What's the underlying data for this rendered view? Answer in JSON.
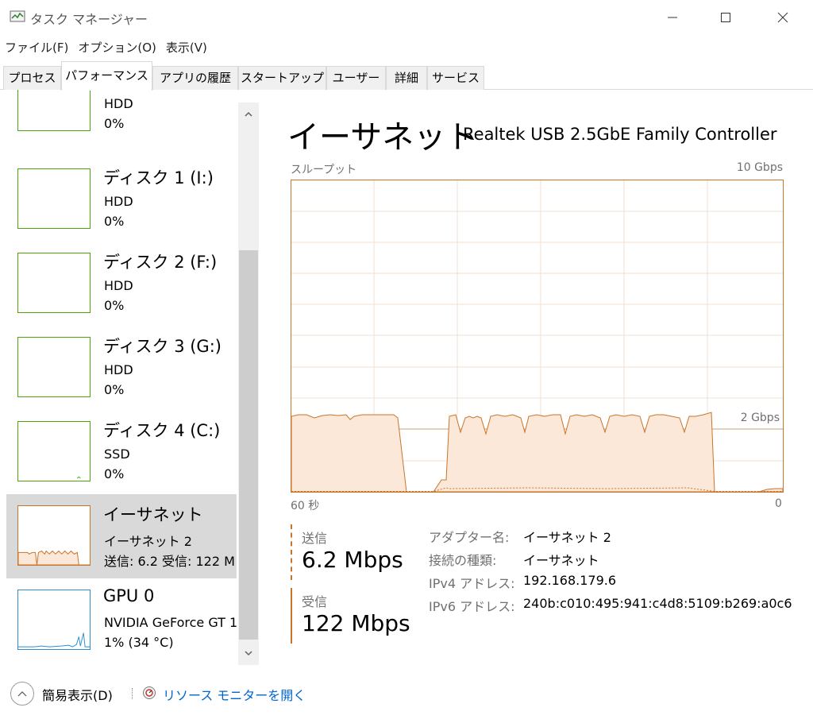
{
  "window": {
    "title": "タスク マネージャー",
    "icon": "task-manager-icon"
  },
  "menu": [
    "ファイル(F)",
    "オプション(O)",
    "表示(V)"
  ],
  "tabs": [
    {
      "label": "プロセス",
      "active": false
    },
    {
      "label": "パフォーマンス",
      "active": true
    },
    {
      "label": "アプリの履歴",
      "active": false
    },
    {
      "label": "スタートアップ",
      "active": false
    },
    {
      "label": "ユーザー",
      "active": false
    },
    {
      "label": "詳細",
      "active": false
    },
    {
      "label": "サービス",
      "active": false
    }
  ],
  "sidebar": {
    "items": [
      {
        "name": "",
        "sub": "HDD",
        "value": "0%"
      },
      {
        "name": "ディスク 1 (I:)",
        "sub": "HDD",
        "value": "0%"
      },
      {
        "name": "ディスク 2 (F:)",
        "sub": "HDD",
        "value": "0%"
      },
      {
        "name": "ディスク 3 (G:)",
        "sub": "HDD",
        "value": "0%"
      },
      {
        "name": "ディスク 4 (C:)",
        "sub": "SSD",
        "value": "0%"
      },
      {
        "name": "イーサネット",
        "sub": "イーサネット 2",
        "value": "送信: 6.2  受信: 122 M"
      },
      {
        "name": "GPU 0",
        "sub": "NVIDIA GeForce GT 1",
        "value": "1% (34 °C)"
      }
    ]
  },
  "main": {
    "title": "イーサネット",
    "device": "Realtek USB 2.5GbE Family Controller",
    "graph": {
      "label_left": "スループット",
      "label_right": "10 Gbps",
      "line_label": "2 Gbps",
      "axis_left": "60 秒",
      "axis_right": "0"
    },
    "send": {
      "label": "送信",
      "value": "6.2 Mbps"
    },
    "receive": {
      "label": "受信",
      "value": "122 Mbps"
    },
    "details": [
      {
        "key": "アダプター名:",
        "value": "イーサネット 2"
      },
      {
        "key": "接続の種類:",
        "value": "イーサネット"
      },
      {
        "key": "IPv4 アドレス:",
        "value": "192.168.179.6"
      },
      {
        "key": "IPv6 アドレス:",
        "value": "240b:c010:495:941:c4d8:5109:b269:a0c6"
      }
    ]
  },
  "footer": {
    "collapse_label": "簡易表示(D)",
    "monitor_link": "リソース モニターを開く"
  },
  "colors": {
    "disk_green": "#4da60c",
    "network_orange": "#c8752a",
    "network_fill": "#fce8d8",
    "gpu_blue": "#2f8fce",
    "selected_bg": "#d9d9d9",
    "link_blue": "#0066cc"
  }
}
